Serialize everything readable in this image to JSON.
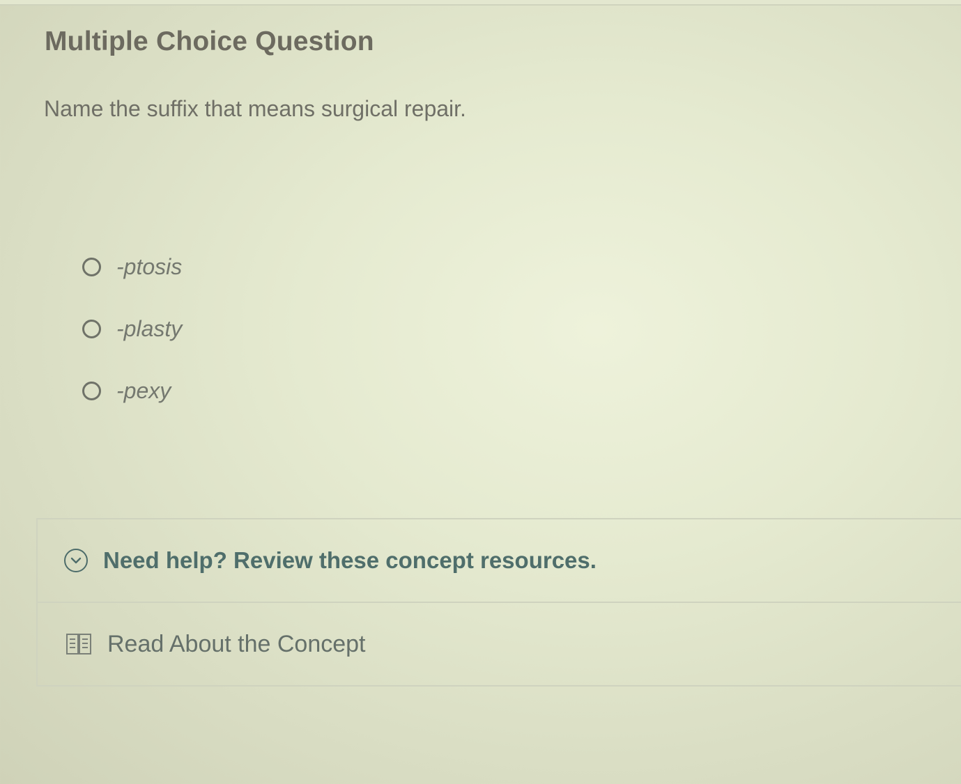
{
  "question": {
    "heading": "Multiple Choice Question",
    "prompt": "Name the suffix that means surgical repair."
  },
  "options": [
    {
      "label": "-ptosis"
    },
    {
      "label": "-plasty"
    },
    {
      "label": "-pexy"
    }
  ],
  "help": {
    "title": "Need help? Review these concept resources.",
    "toggle_icon": "chevron-down-circle-icon",
    "resources": [
      {
        "label": "Read About the Concept",
        "icon": "book-icon"
      }
    ]
  },
  "colors": {
    "help_accent": "#4f6e6b",
    "text_muted": "#6f6f66"
  }
}
